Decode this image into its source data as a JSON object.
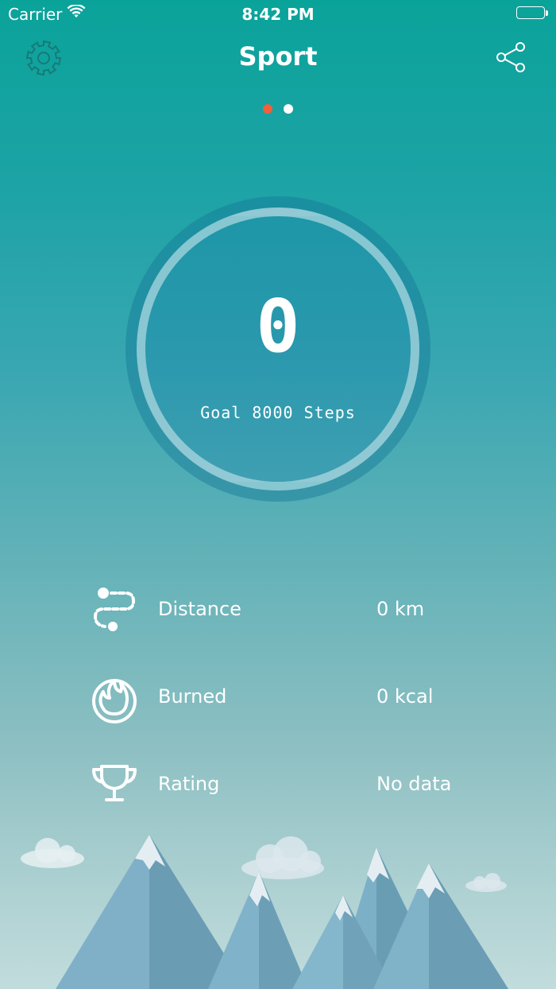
{
  "status_bar": {
    "carrier": "Carrier",
    "time": "8:42 PM"
  },
  "header": {
    "title": "Sport",
    "settings_icon": "gear-icon",
    "share_icon": "share-icon"
  },
  "pager": {
    "page_count": 2,
    "current_page": 1,
    "active_color": "#f0603a"
  },
  "steps_ring": {
    "steps": "0",
    "goal_text": "Goal 8000 Steps"
  },
  "stats": [
    {
      "icon": "route-icon",
      "label": "Distance",
      "value": "0 km"
    },
    {
      "icon": "flame-icon",
      "label": "Burned",
      "value": "0 kcal"
    },
    {
      "icon": "trophy-icon",
      "label": "Rating",
      "value": "No data"
    }
  ],
  "colors": {
    "accent": "#f0603a",
    "background_top": "#0aa39a",
    "background_bottom": "#c2dcdc"
  }
}
